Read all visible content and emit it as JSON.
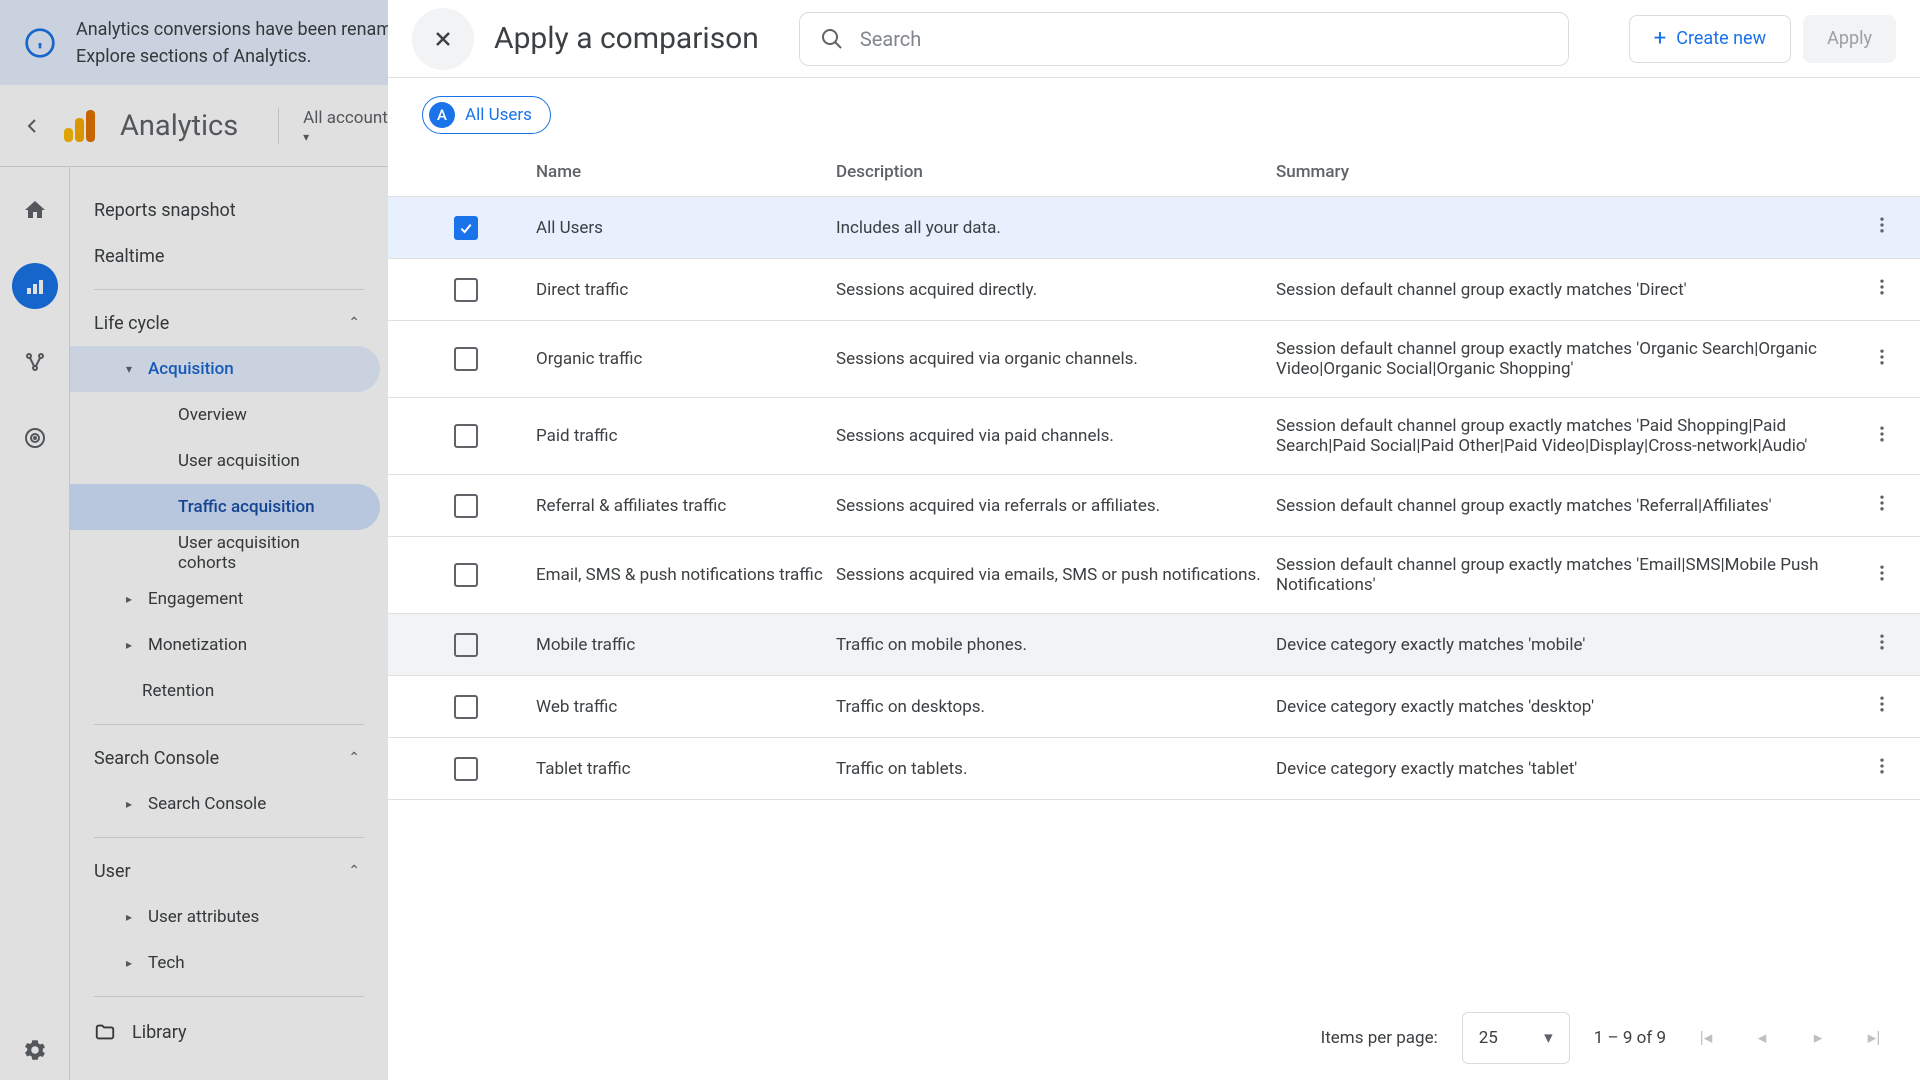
{
  "banner": {
    "text": "Analytics conversions have been renamed …\nExplore sections of Analytics."
  },
  "topbar": {
    "product": "Analytics",
    "account_label": "All accounts"
  },
  "sidenav": {
    "reports_snapshot": "Reports snapshot",
    "realtime": "Realtime",
    "life_cycle": "Life cycle",
    "acquisition": "Acquisition",
    "overview": "Overview",
    "user_acq": "User acquisition",
    "traffic_acq": "Traffic acquisition",
    "user_acq_cohorts": "User acquisition cohorts",
    "engagement": "Engagement",
    "monetization": "Monetization",
    "retention": "Retention",
    "search_console_grp": "Search Console",
    "search_console": "Search Console",
    "user_grp": "User",
    "user_attributes": "User attributes",
    "tech": "Tech",
    "library": "Library"
  },
  "dialog": {
    "title": "Apply a comparison",
    "search_placeholder": "Search",
    "create_new": "Create new",
    "apply": "Apply",
    "chip_label": "All Users",
    "chip_badge": "A",
    "columns": {
      "name": "Name",
      "description": "Description",
      "summary": "Summary"
    },
    "rows": [
      {
        "checked": true,
        "name": "All Users",
        "desc": "Includes all your data.",
        "summary": ""
      },
      {
        "checked": false,
        "name": "Direct traffic",
        "desc": "Sessions acquired directly.",
        "summary": "Session default channel group exactly matches 'Direct'"
      },
      {
        "checked": false,
        "name": "Organic traffic",
        "desc": "Sessions acquired via organic channels.",
        "summary": "Session default channel group exactly matches 'Organic Search|Organic Video|Organic Social|Organic Shopping'"
      },
      {
        "checked": false,
        "name": "Paid traffic",
        "desc": "Sessions acquired via paid channels.",
        "summary": "Session default channel group exactly matches 'Paid Shopping|Paid Search|Paid Social|Paid Other|Paid Video|Display|Cross-network|Audio'"
      },
      {
        "checked": false,
        "name": "Referral & affiliates traffic",
        "desc": "Sessions acquired via referrals or affiliates.",
        "summary": "Session default channel group exactly matches 'Referral|Affiliates'"
      },
      {
        "checked": false,
        "name": "Email, SMS & push notifications traffic",
        "desc": "Sessions acquired via emails, SMS or push notifications.",
        "summary": "Session default channel group exactly matches 'Email|SMS|Mobile Push Notifications'"
      },
      {
        "checked": false,
        "hover": true,
        "name": "Mobile traffic",
        "desc": "Traffic on mobile phones.",
        "summary": "Device category exactly matches 'mobile'"
      },
      {
        "checked": false,
        "name": "Web traffic",
        "desc": "Traffic on desktops.",
        "summary": "Device category exactly matches 'desktop'"
      },
      {
        "checked": false,
        "name": "Tablet traffic",
        "desc": "Traffic on tablets.",
        "summary": "Device category exactly matches 'tablet'"
      }
    ],
    "pager": {
      "items_label": "Items per page:",
      "per_page": "25",
      "range": "1 – 9 of 9"
    }
  }
}
